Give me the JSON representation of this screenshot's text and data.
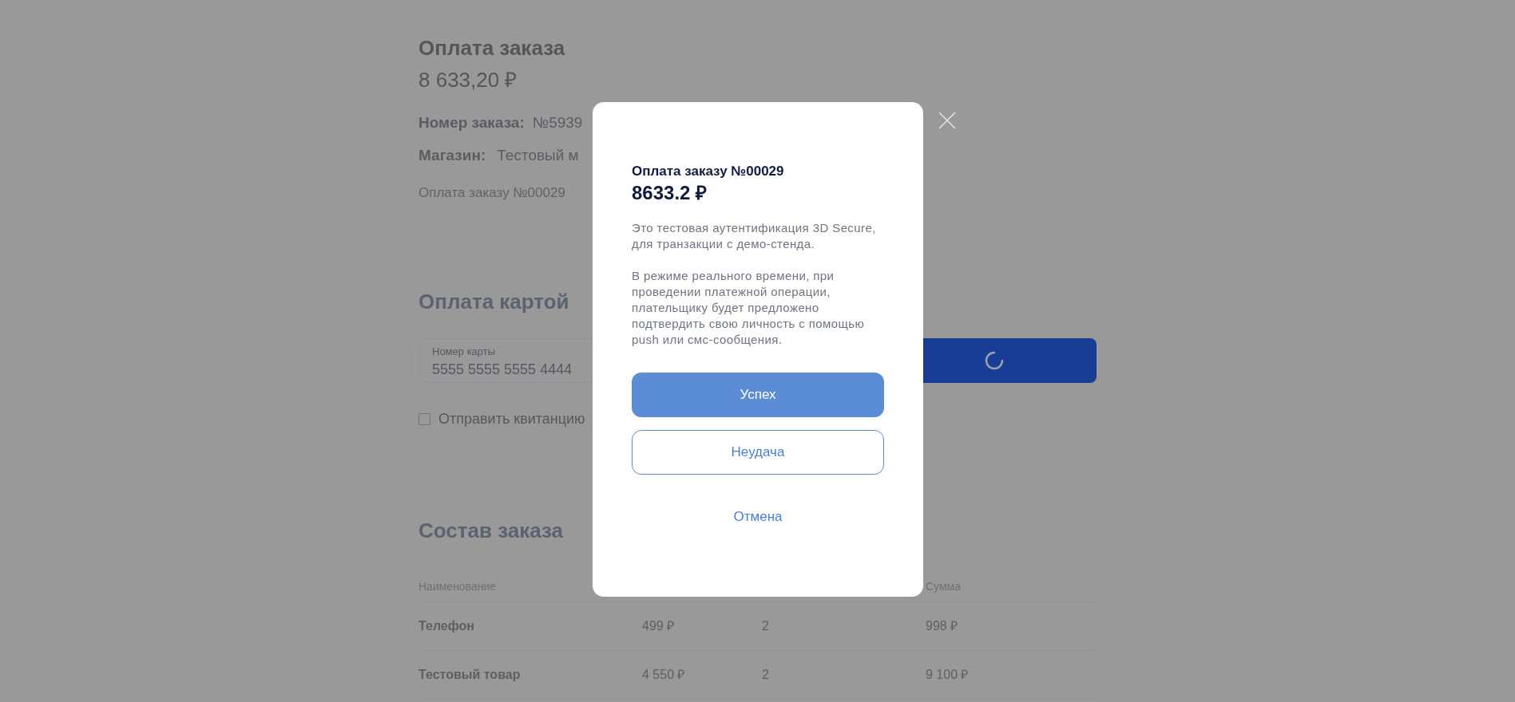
{
  "order": {
    "title": "Оплата заказа",
    "amount": "8 633,20 ₽",
    "number_label": "Номер заказа:",
    "number_value": "№5939",
    "store_label": "Магазин:",
    "store_value": "Тестовый м",
    "description": "Оплата заказу №00029"
  },
  "card_payment": {
    "title": "Оплата картой",
    "card_field": {
      "label": "Номер карты",
      "value": "5555 5555 5555 4444"
    },
    "pay_button": {
      "loading": true
    },
    "receipt_checkbox": {
      "label": "Отправить квитанцию",
      "checked": false
    }
  },
  "order_items": {
    "title": "Состав заказа",
    "columns": [
      "Наименование",
      null,
      null,
      "Сумма"
    ],
    "rows": [
      [
        "Телефон",
        "499 ₽",
        "2",
        "998 ₽"
      ],
      [
        "Тестовый товар",
        "4 550 ₽",
        "2",
        "9 100 ₽"
      ]
    ]
  },
  "modal": {
    "title": "Оплата заказу №00029",
    "amount": "8633.2 ₽",
    "paragraphs": [
      "Это тестовая аутентификация 3D Secure, для транзакции с демо-стенда.",
      "В режиме реального времени, при проведении платежной операции, плательщику будет предложено подтвердить свою личность с помощью push или смс-сообщения."
    ],
    "buttons": [
      {
        "label": "Успех",
        "kind": "primary"
      },
      {
        "label": "Неудача",
        "kind": "outline"
      },
      {
        "label": "Отмена",
        "kind": "link"
      }
    ]
  }
}
